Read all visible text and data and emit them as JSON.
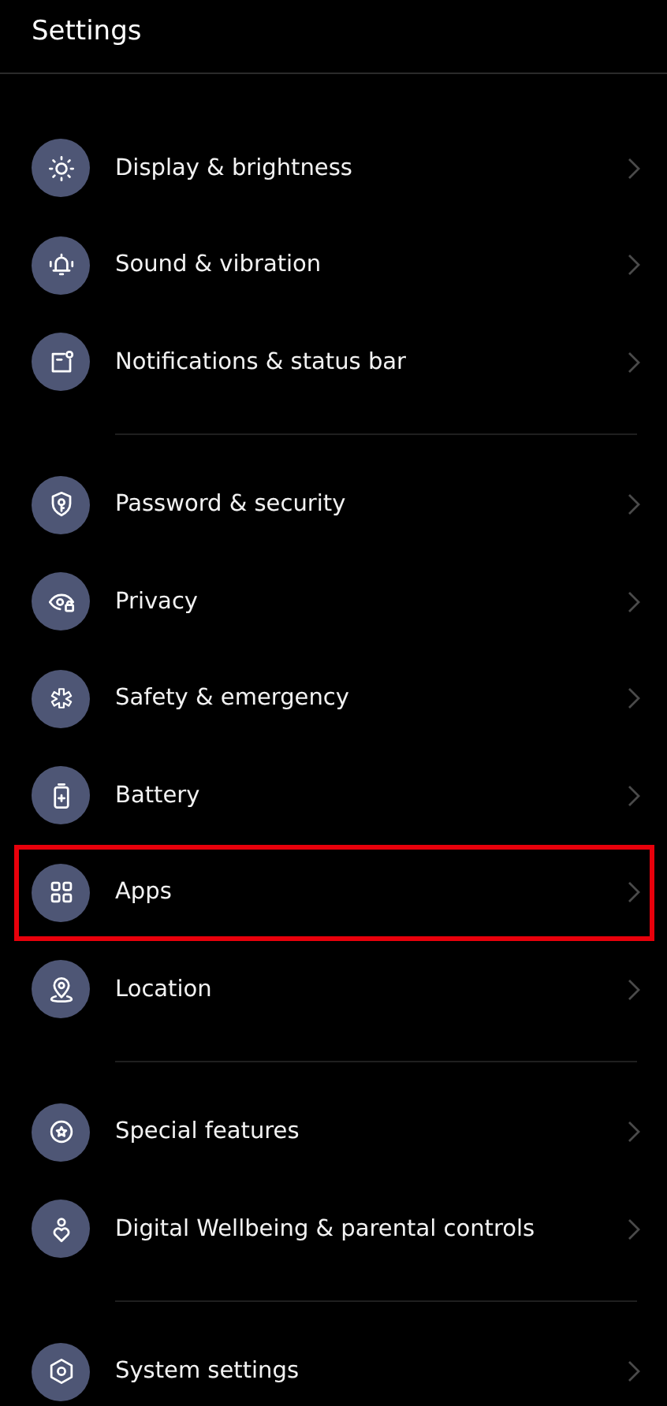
{
  "header": {
    "title": "Settings"
  },
  "sections": [
    {
      "items": [
        {
          "label": "Display & brightness",
          "highlighted": false
        },
        {
          "label": "Sound & vibration",
          "highlighted": false
        },
        {
          "label": "Notifications & status bar",
          "highlighted": false
        }
      ]
    },
    {
      "items": [
        {
          "label": "Password & security",
          "highlighted": false
        },
        {
          "label": "Privacy",
          "highlighted": false
        },
        {
          "label": "Safety & emergency",
          "highlighted": false
        },
        {
          "label": "Battery",
          "highlighted": false
        },
        {
          "label": "Apps",
          "highlighted": true
        },
        {
          "label": "Location",
          "highlighted": false
        }
      ]
    },
    {
      "items": [
        {
          "label": "Special features",
          "highlighted": false
        },
        {
          "label": "Digital Wellbeing & parental controls",
          "highlighted": false
        }
      ]
    },
    {
      "items": [
        {
          "label": "System settings",
          "highlighted": false
        }
      ]
    }
  ]
}
